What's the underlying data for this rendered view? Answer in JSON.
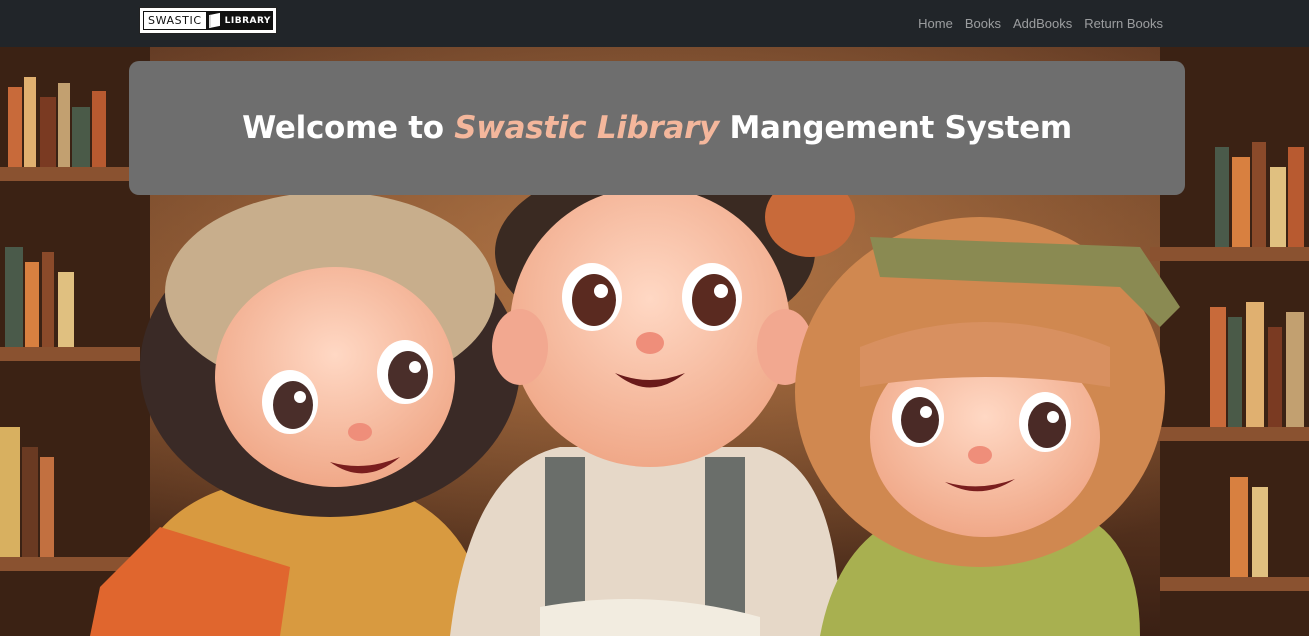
{
  "navbar": {
    "brand": {
      "left_text": "SWASTIC",
      "right_text": "LIBRARY",
      "icon": "book-icon"
    },
    "links": [
      "Home",
      "Books",
      "AddBooks",
      "Return Books"
    ]
  },
  "banner": {
    "prefix": "Welcome to ",
    "highlight": "Swastic Library",
    "suffix": " Mangement System",
    "highlight_color": "#f4b79c"
  },
  "colors": {
    "navbar_bg": "#212529",
    "banner_bg": "#6e6e6e"
  }
}
